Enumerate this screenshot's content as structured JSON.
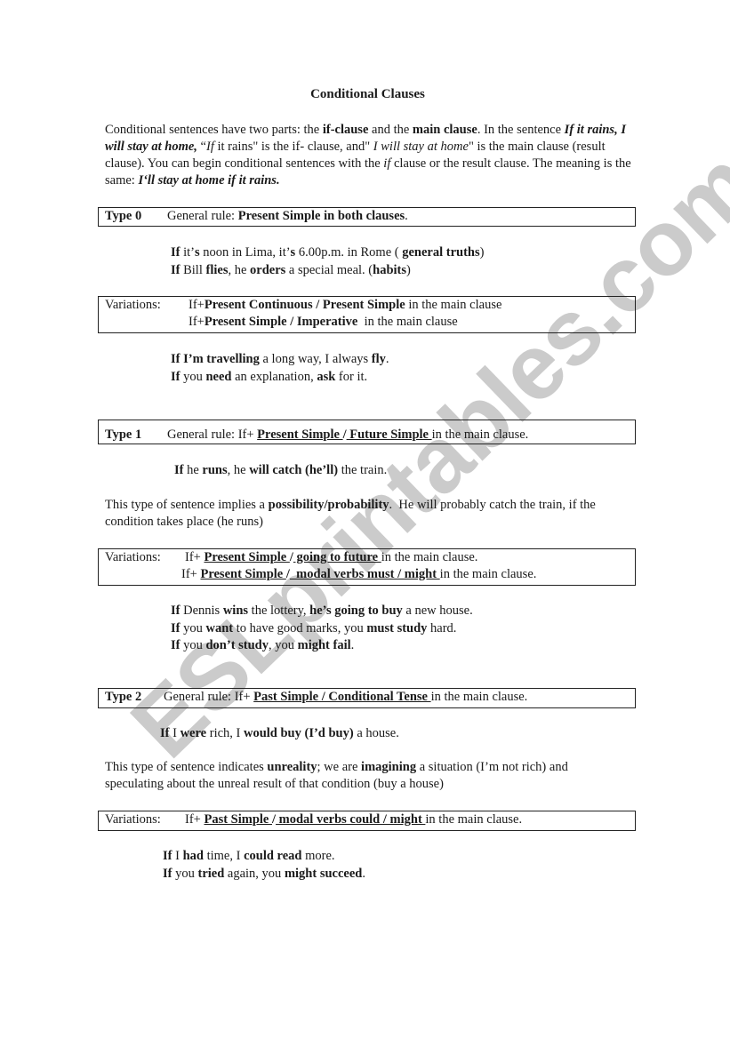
{
  "watermark": "ESLprintables.com",
  "title": "Conditional Clauses",
  "intro": {
    "s1_a": "Conditional sentences have two parts: the ",
    "s1_b": "if-clause",
    "s1_c": " and the ",
    "s1_d": "main clause",
    "s1_e": ". In the sentence ",
    "s2_a": "If it rains, I will stay at home,",
    "s2_b": " “",
    "s2_c": "If",
    "s2_d": " it rains\" is the if- clause, and\" ",
    "s2_e": "I will stay at home",
    "s2_f": "\" is the main clause (result clause).  You can begin conditional sentences with the ",
    "s2_g": "if",
    "s2_h": " clause or the result clause. The meaning is the same: ",
    "s2_i": "I‘ll stay at home if it rains."
  },
  "type0": {
    "label": "Type 0",
    "rule_prefix": "General rule: ",
    "rule_bold": "Present Simple in both clauses",
    "rule_suffix": ".",
    "examples": [
      {
        "p1": "If",
        "p2": " it’",
        "p3": "s",
        "p4": " noon in Lima, it’",
        "p5": "s",
        "p6": " 6.00p.m. in Rome ( ",
        "p7": "general truths",
        "p8": ")"
      },
      {
        "p1": "If",
        "p2": " Bill ",
        "p3": "flies",
        "p4": ", he ",
        "p5": "orders",
        "p6": " a special meal. (",
        "p7": "habits",
        "p8": ")"
      }
    ],
    "variations": {
      "label": "Variations:",
      "line1_a": "If+",
      "line1_b": "Present Continuous / Present Simple",
      "line1_c": " in the main clause",
      "line2_a": "If+",
      "line2_b": "Present Simple / Imperative",
      "line2_c": "  in the main clause"
    },
    "var_examples": [
      {
        "p1": "If I’m travelling",
        "p2": " a long way, I always ",
        "p3": "fly",
        "p4": "."
      },
      {
        "p1": "If",
        "p2": " you ",
        "p3": "need",
        "p4": " an explanation, ",
        "p5": "ask",
        "p6": " for it."
      }
    ]
  },
  "type1": {
    "label": "Type 1",
    "rule_prefix": "General rule: If+ ",
    "rule_u1": "Present Simple ",
    "rule_sep": "/",
    "rule_u2": " Future Simple ",
    "rule_suffix": "in the main clause.",
    "example": {
      "p1": "If",
      "p2": " he ",
      "p3": "runs",
      "p4": ", he ",
      "p5": "will catch (he’ll)",
      "p6": " the train."
    },
    "explanation": {
      "a": "This type of sentence implies a ",
      "b": "possibility/probability",
      "c": ".  He will probably catch the train, if the condition takes place (he runs)"
    },
    "variations": {
      "label": "Variations:",
      "line1_a": "If+ ",
      "line1_u1": "Present Simple ",
      "line1_sep": "/",
      "line1_u2": " going to future ",
      "line1_c": "in the main clause.",
      "line2_a": "If+ ",
      "line2_u1": "Present Simple ",
      "line2_sep": "/",
      "line2_u2": "  modal verbs must / might ",
      "line2_c": "in the main clause."
    },
    "var_examples": [
      {
        "p1": "If",
        "p2": " Dennis ",
        "p3": "wins",
        "p4": " the lottery, ",
        "p5": "he’s going to buy",
        "p6": " a new house."
      },
      {
        "p1": "If",
        "p2": " you ",
        "p3": "want",
        "p4": " to have good marks, you ",
        "p5": "must study",
        "p6": " hard."
      },
      {
        "p1": "If",
        "p2": " you ",
        "p3": "don’t study",
        "p4": ", you ",
        "p5": "might fail",
        "p6": "."
      }
    ]
  },
  "type2": {
    "label": "Type 2",
    "rule_prefix": "General rule: If+ ",
    "rule_u": "Past Simple / Conditional Tense ",
    "rule_suffix": "in the main clause.",
    "example": {
      "p1": "If",
      "p2": " I ",
      "p3": "were",
      "p4": " rich, I ",
      "p5": "would buy (I’d buy)",
      "p6": " a house."
    },
    "explanation": {
      "a": "This type of sentence indicates ",
      "b": "unreality",
      "c": "; we are ",
      "d": "imagining",
      "e": " a situation (I’m not rich) and speculating about the unreal result of that condition (buy a house)"
    },
    "variations": {
      "label": "Variations:",
      "line1_a": "If+ ",
      "line1_u1": "Past Simple ",
      "line1_sep": "/",
      "line1_u2": " modal verbs could / might ",
      "line1_c": "in the main clause."
    },
    "var_examples": [
      {
        "p1": "If",
        "p2": " I ",
        "p3": "had",
        "p4": " time, I ",
        "p5": "could read",
        "p6": " more."
      },
      {
        "p1": "If",
        "p2": " you ",
        "p3": "tried",
        "p4": " again, you ",
        "p5": "might succeed",
        "p6": "."
      }
    ]
  }
}
